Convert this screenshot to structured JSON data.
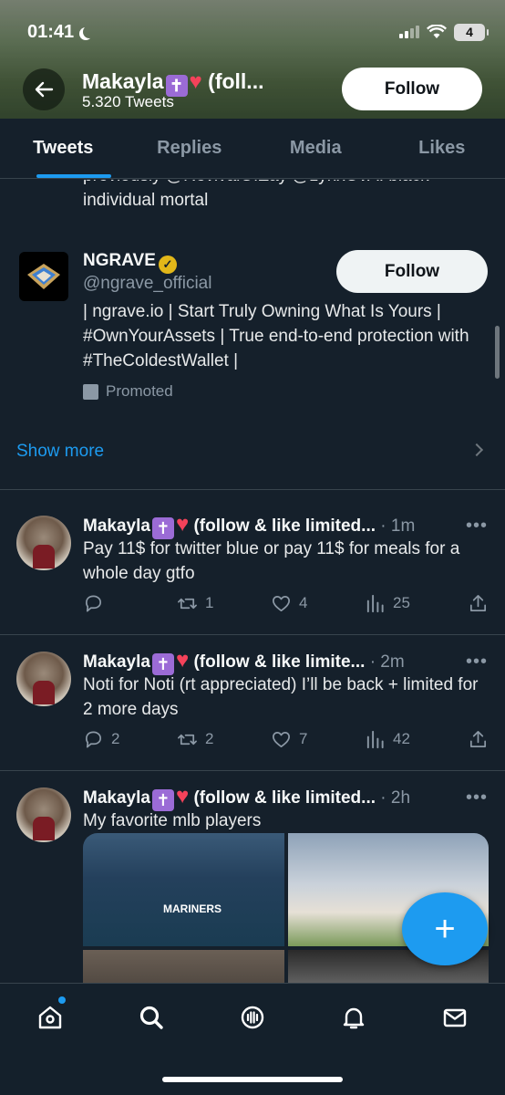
{
  "status_bar": {
    "time": "01:41",
    "battery": "4"
  },
  "header": {
    "name": "Makayla",
    "name_suffix": "(foll...",
    "tweet_count": "5.320 Tweets",
    "follow_label": "Follow"
  },
  "tabs": [
    {
      "label": "Tweets"
    },
    {
      "label": "Replies"
    },
    {
      "label": "Media"
    },
    {
      "label": "Likes"
    }
  ],
  "cut_tweet": {
    "line1": "previously @RevivalOfZay @zynxOvA. black",
    "line2": "individual mortal"
  },
  "promo": {
    "name": "NGRAVE",
    "handle": "@ngrave_official",
    "follow_label": "Follow",
    "bio": "| ngrave.io | Start Truly Owning What Is Yours | #OwnYourAssets | True end-to-end protection with #TheColdestWallet |",
    "promoted_label": "Promoted"
  },
  "show_more": "Show more",
  "tweets": [
    {
      "name": "Makayla",
      "name_suffix": "(follow & like limited...",
      "time": "· 1m",
      "text": "Pay 11$ for twitter blue or pay 11$ for meals for a whole day gtfo",
      "replies": "",
      "retweets": "1",
      "likes": "4",
      "views": "25"
    },
    {
      "name": "Makayla",
      "name_suffix": "(follow & like limite...",
      "time": "· 2m",
      "text": "Noti for Noti (rt appreciated) I’ll be back + limited for 2 more days",
      "replies": "2",
      "retweets": "2",
      "likes": "7",
      "views": "42"
    },
    {
      "name": "Makayla",
      "name_suffix": "(follow & like limited...",
      "time": "· 2h",
      "text": "My favorite mlb players"
    }
  ],
  "fab": {
    "icon": "+"
  },
  "bottom_nav": [
    "home-icon",
    "search-icon",
    "spaces-icon",
    "notifications-icon",
    "messages-icon"
  ],
  "colors": {
    "accent": "#1d9bf0",
    "background": "#15202b"
  }
}
